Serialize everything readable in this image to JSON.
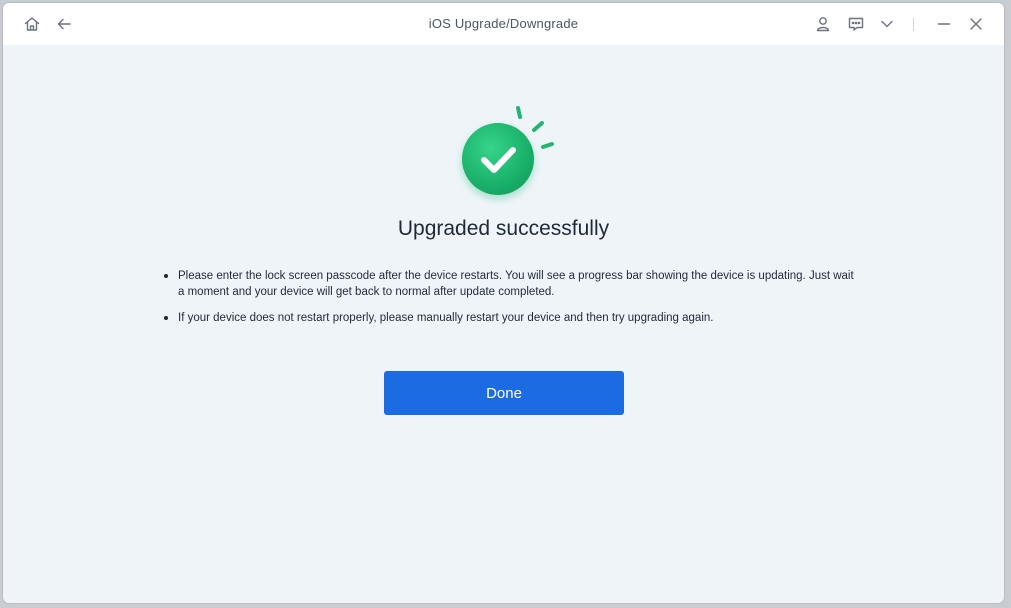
{
  "window": {
    "title": "iOS Upgrade/Downgrade",
    "icons": [
      "home-icon",
      "back-arrow-icon",
      "user-icon",
      "feedback-icon",
      "chevron-down-icon",
      "minimize-icon",
      "close-icon"
    ]
  },
  "result": {
    "status_icon": "success-check-icon",
    "headline": "Upgraded successfully",
    "notes": [
      "Please enter the lock screen passcode after the device restarts. You will see a progress bar showing the device is updating. Just wait a moment and your device will get back to normal after update completed.",
      "If your device does not restart properly, please manually restart your device and then try upgrading again."
    ],
    "done_label": "Done"
  },
  "colors": {
    "accent": "#1b6ce2",
    "success": "#22b573",
    "background": "#eff4f9"
  }
}
